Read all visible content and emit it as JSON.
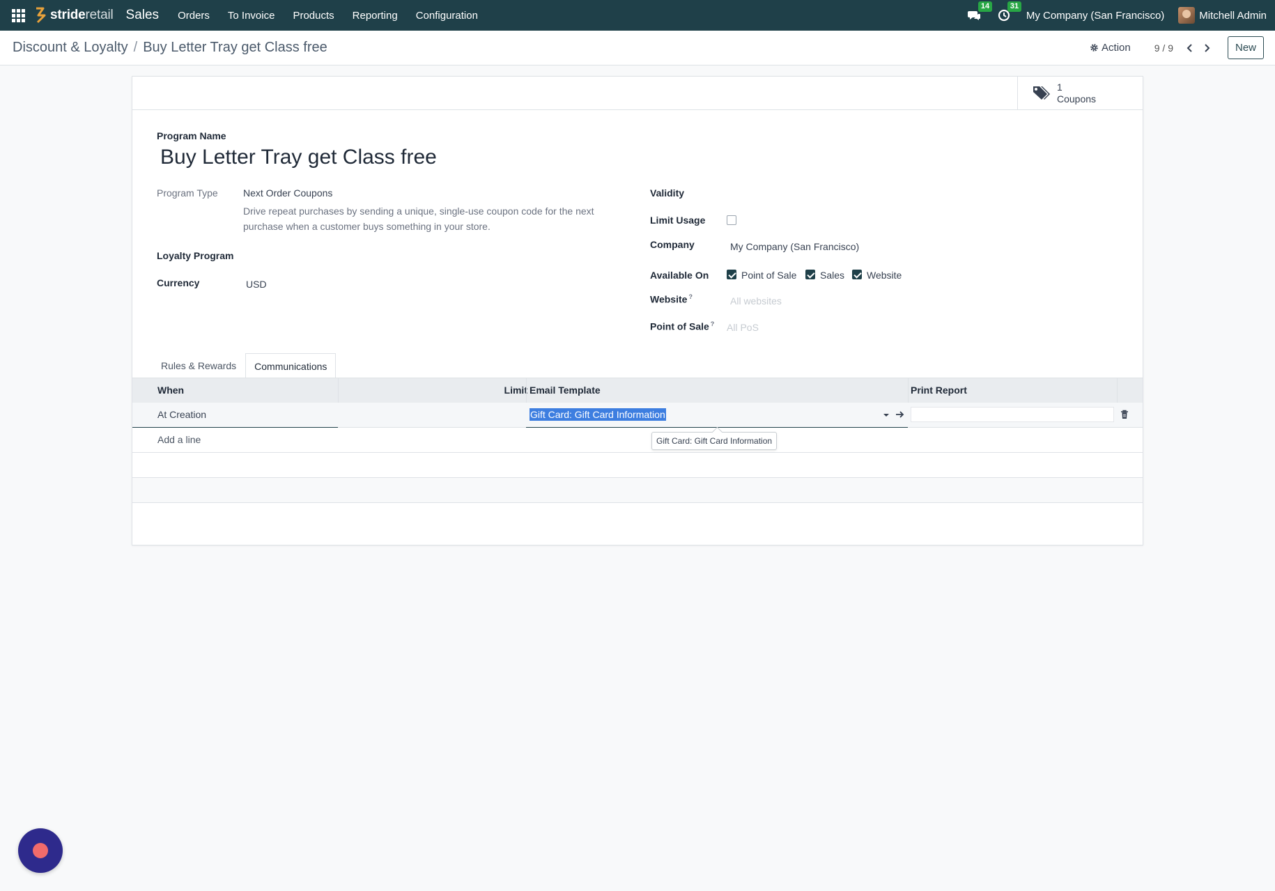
{
  "navbar": {
    "brand_bold": "stride",
    "brand_light": "retail",
    "app_name": "Sales",
    "menu": [
      "Orders",
      "To Invoice",
      "Products",
      "Reporting",
      "Configuration"
    ],
    "messages_count": "14",
    "activities_count": "31",
    "company": "My Company (San Francisco)",
    "user": "Mitchell Admin",
    "bg_color": "#1f4049"
  },
  "control_panel": {
    "breadcrumb_parent": "Discount & Loyalty",
    "breadcrumb_separator": "/",
    "breadcrumb_current": "Buy Letter Tray get Class free",
    "action_label": "Action",
    "pager": "9 / 9",
    "new_label": "New"
  },
  "stat_button": {
    "value": "1",
    "label": "Coupons"
  },
  "form": {
    "program_name_label": "Program Name",
    "program_name": "Buy Letter Tray get Class free",
    "program_type_label": "Program Type",
    "program_type": "Next Order Coupons",
    "program_type_desc": "Drive repeat purchases by sending a unique, single-use coupon code for the next purchase when a customer buys something in your store.",
    "loyalty_program_label": "Loyalty Program",
    "currency_label": "Currency",
    "currency": "USD",
    "validity_label": "Validity",
    "limit_usage_label": "Limit Usage",
    "company_label": "Company",
    "company": "My Company (San Francisco)",
    "available_on_label": "Available On",
    "available_on": [
      "Point of Sale",
      "Sales",
      "Website"
    ],
    "website_label": "Website",
    "website_placeholder": "All websites",
    "pos_label": "Point of Sale",
    "pos_placeholder": "All PoS",
    "help_mark": "?"
  },
  "tabs": [
    "Rules & Rewards",
    "Communications"
  ],
  "table": {
    "headers": {
      "when": "When",
      "limit": "Limit",
      "email_template": "Email Template",
      "print_report": "Print Report"
    },
    "rows": [
      {
        "when": "At Creation",
        "limit": "",
        "email_template": "Gift Card: Gift Card Information",
        "print_report": ""
      }
    ],
    "add_line": "Add a line"
  },
  "tooltip": "Gift Card: Gift Card Information"
}
